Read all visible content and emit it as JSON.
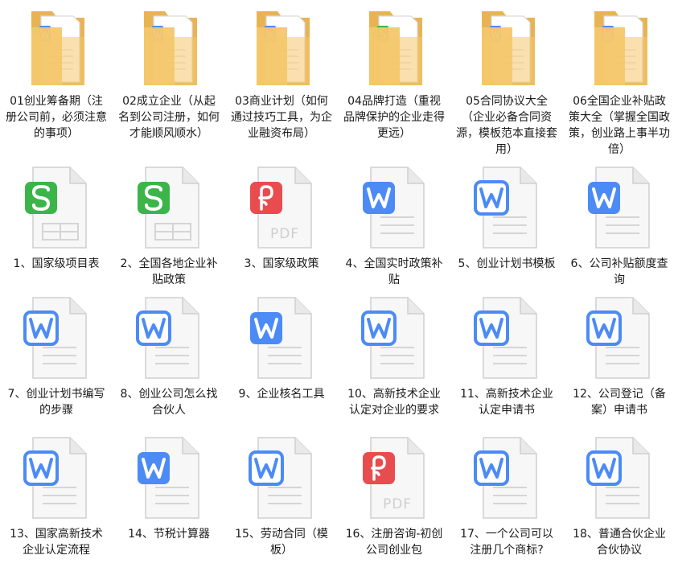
{
  "colors": {
    "folder": "#F4C76B",
    "folder_dark": "#E8B453",
    "word": "#4C8BF5",
    "sheet": "#3BB54A",
    "pdf": "#E84C4F",
    "page": "#F7F7F7",
    "page_line": "#D5D5D5"
  },
  "items": [
    {
      "type": "folder",
      "badge": "word",
      "label": "01创业筹备期（注册公司前，必须注意的事项）"
    },
    {
      "type": "folder",
      "badge": "word",
      "label": "02成立企业（从起名到公司注册，如何才能顺风顺水）"
    },
    {
      "type": "folder",
      "badge": "word",
      "label": "03商业计划（如何通过技巧工具，为企业融资布局）"
    },
    {
      "type": "folder",
      "badge": "sheet",
      "label": "04品牌打造（重视品牌保护的企业走得更远）"
    },
    {
      "type": "folder",
      "badge": "word",
      "label": "05合同协议大全（企业必备合同资源，模板范本直接套用）"
    },
    {
      "type": "folder",
      "badge": "word",
      "label": "06全国企业补贴政策大全（掌握全国政策，创业路上事半功倍）"
    },
    {
      "type": "sheet",
      "label": "1、国家级项目表"
    },
    {
      "type": "sheet",
      "label": "2、全国各地企业补贴政策"
    },
    {
      "type": "pdf",
      "label": "3、国家级政策"
    },
    {
      "type": "word",
      "label": "4、全国实时政策补贴"
    },
    {
      "type": "word-outline",
      "label": "5、创业计划书模板"
    },
    {
      "type": "word",
      "label": "6、公司补贴额度查询"
    },
    {
      "type": "word-outline",
      "label": "7、创业计划书编写的步骤"
    },
    {
      "type": "word-outline",
      "label": "8、创业公司怎么找合伙人"
    },
    {
      "type": "word",
      "label": "9、企业核名工具"
    },
    {
      "type": "word-outline",
      "label": "10、高新技术企业认定对企业的要求"
    },
    {
      "type": "word-outline",
      "label": "11、高新技术企业认定申请书"
    },
    {
      "type": "word-outline",
      "label": "12、公司登记（备案）申请书"
    },
    {
      "type": "word-outline",
      "label": "13、国家高新技术企业认定流程"
    },
    {
      "type": "word",
      "label": "14、节税计算器"
    },
    {
      "type": "word-outline",
      "label": "15、劳动合同（模板）"
    },
    {
      "type": "pdf",
      "label": "16、注册咨询-初创公司创业包"
    },
    {
      "type": "word-outline",
      "label": "17、一个公司可以注册几个商标?"
    },
    {
      "type": "word-outline",
      "label": "18、普通合伙企业合伙协议"
    }
  ]
}
